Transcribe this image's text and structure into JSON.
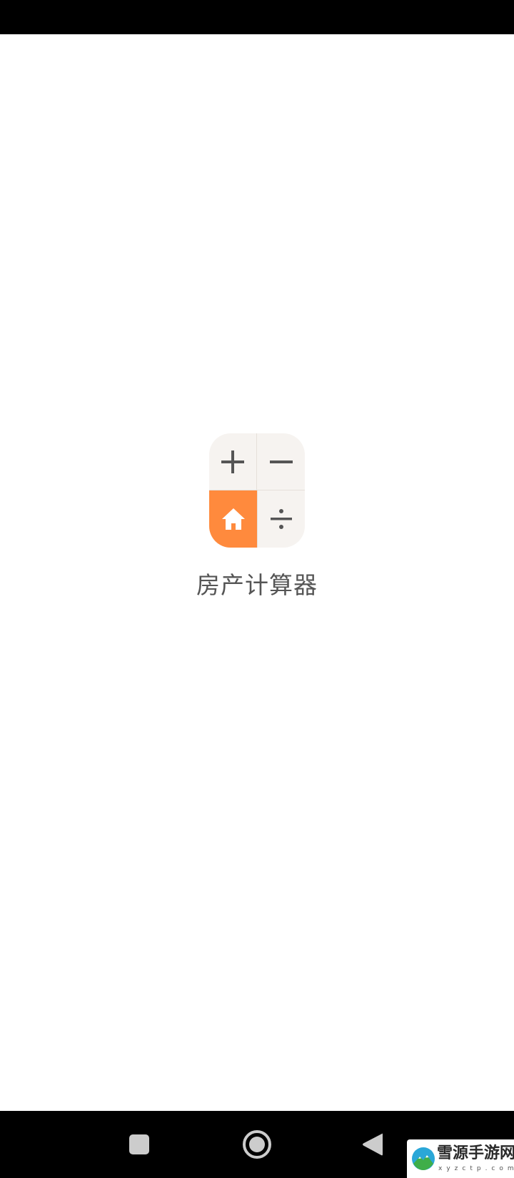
{
  "splash": {
    "app_name": "房产计算器",
    "icon": {
      "cells": [
        "plus-icon",
        "minus-icon",
        "house-icon",
        "divide-icon"
      ],
      "accent_color": "#ff8a3d",
      "tile_color": "#f6f3f0",
      "symbol_color": "#555555"
    }
  },
  "nav_bar": {
    "buttons": [
      "recent-apps-icon",
      "home-icon",
      "back-icon"
    ],
    "color": "#000000",
    "icon_color": "#cccccc"
  },
  "watermark": {
    "title": "雪源手游网",
    "subtitle": "xyzctp.com"
  }
}
